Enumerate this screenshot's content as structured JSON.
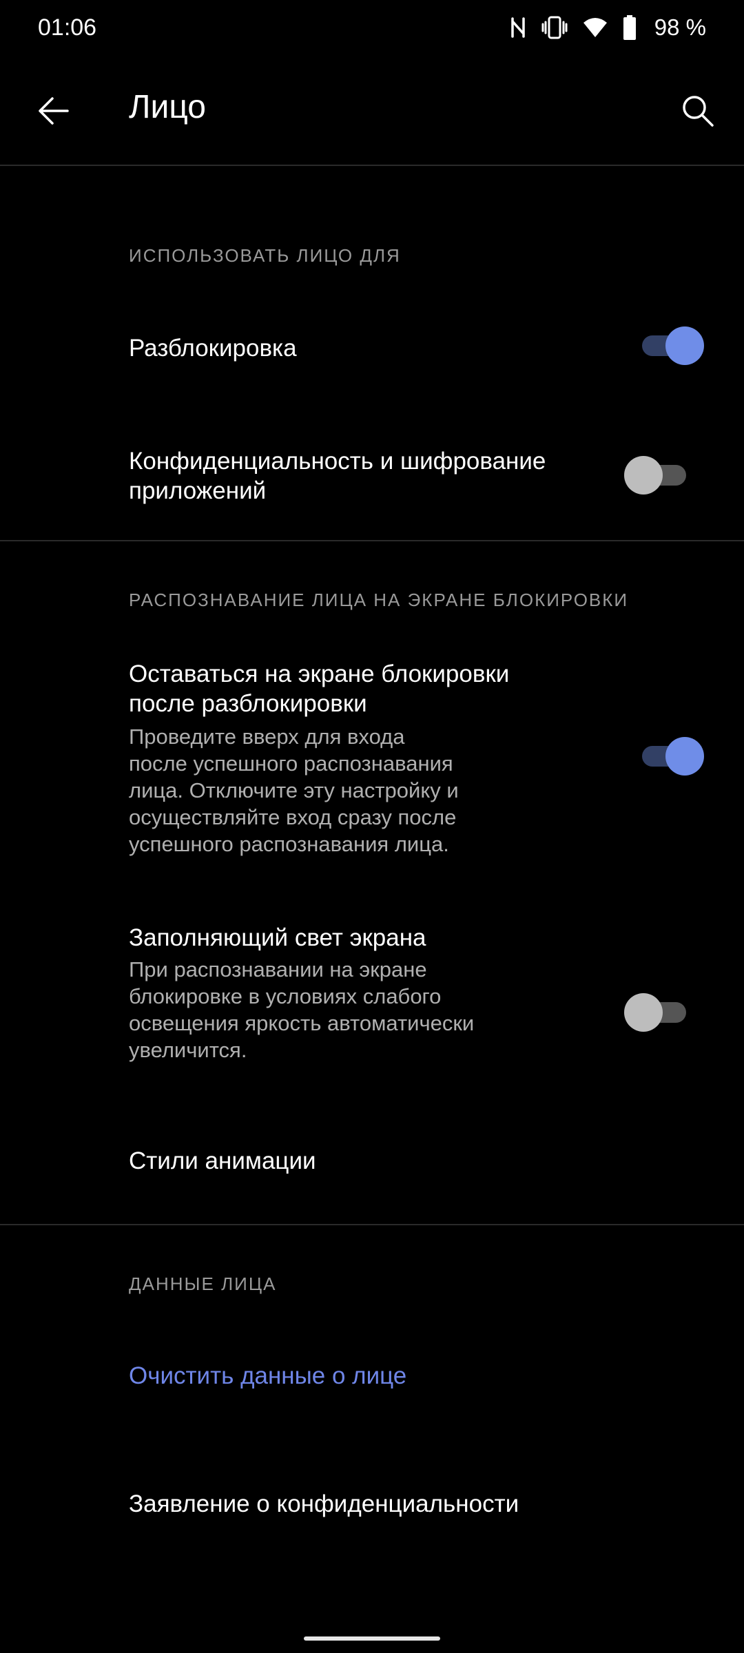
{
  "status_bar": {
    "time": "01:06",
    "battery_text": "98 %",
    "icons": [
      "nfc-icon",
      "vibrate-icon",
      "wifi-icon",
      "battery-icon"
    ]
  },
  "app_bar": {
    "title": "Лицо",
    "back_icon": "arrow-left-icon",
    "search_icon": "search-icon"
  },
  "sections": {
    "use_face": {
      "header": "ИСПОЛЬЗОВАТЬ ЛИЦО ДЛЯ",
      "unlock": {
        "title": "Разблокировка",
        "enabled": true
      },
      "privacy": {
        "title_line1": "Конфиденциальность и шифрование",
        "title_line2": "приложений",
        "enabled": false
      }
    },
    "lock_screen": {
      "header": "РАСПОЗНАВАНИЕ ЛИЦА НА ЭКРАНЕ БЛОКИРОВКИ",
      "stay": {
        "title_line1": "Оставаться на экране блокировки",
        "title_line2": "после разблокировки",
        "summary": [
          "Проведите вверх для входа",
          "после успешного распознавания",
          "лица. Отключите эту настройку и",
          "осуществляйте вход сразу после",
          "успешного распознавания лица."
        ],
        "enabled": true
      },
      "fill_light": {
        "title": "Заполняющий свет экрана",
        "summary": [
          "При распознавании на экране",
          "блокировке в условиях слабого",
          "освещения яркость автоматически",
          "увеличится."
        ],
        "enabled": false
      },
      "animation": {
        "title": "Стили анимации"
      }
    },
    "face_data": {
      "header": "ДАННЫЕ ЛИЦА",
      "clear": {
        "title": "Очистить данные о лице"
      },
      "privacy_statement": {
        "title": "Заявление о конфиденциальности"
      }
    }
  },
  "colors": {
    "background": "#000000",
    "accent": "#6f8de8",
    "link": "#6f86e8",
    "section_header": "#9a9a9a"
  }
}
